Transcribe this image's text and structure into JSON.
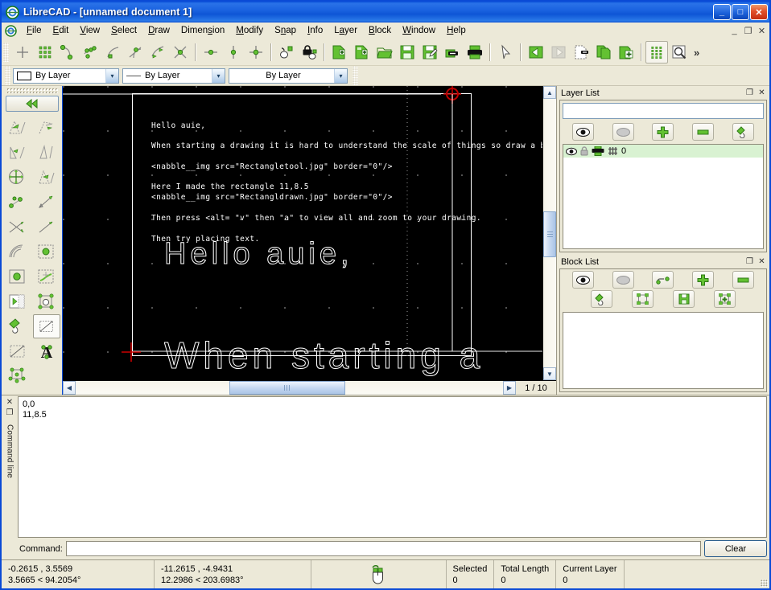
{
  "window": {
    "title": "LibreCAD - [unnamed document 1]",
    "minimize": "_",
    "maximize": "□",
    "close": "✕"
  },
  "menubar": {
    "items": [
      {
        "label": "File"
      },
      {
        "label": "Edit"
      },
      {
        "label": "View"
      },
      {
        "label": "Select"
      },
      {
        "label": "Draw"
      },
      {
        "label": "Dimension"
      },
      {
        "label": "Modify"
      },
      {
        "label": "Snap"
      },
      {
        "label": "Info"
      },
      {
        "label": "Layer"
      },
      {
        "label": "Block"
      },
      {
        "label": "Window"
      },
      {
        "label": "Help"
      }
    ],
    "mdi_minimize": "_",
    "mdi_restore": "❐",
    "mdi_close": "✕"
  },
  "toolbar": {
    "snap_tools": [
      "snap-free-icon",
      "snap-grid-icon",
      "snap-endpoint-icon",
      "snap-entity-icon",
      "snap-on-entity-icon",
      "snap-center-icon",
      "snap-middle-icon",
      "snap-intersection-icon"
    ],
    "restrict_tools": [
      "restrict-horizontal-icon",
      "restrict-vertical-icon",
      "restrict-orthogonal-icon"
    ],
    "lock_tools": [
      "relative-zero-icon",
      "lock-relative-zero-icon"
    ],
    "file_tools": [
      "new-file-icon",
      "new-from-template-icon",
      "open-file-icon",
      "save-icon",
      "save-as-icon",
      "export-icon",
      "print-icon"
    ],
    "edit_tools": [
      "select-pointer-icon",
      "undo-icon",
      "redo-icon",
      "cut-icon",
      "copy-icon",
      "paste-icon"
    ],
    "view_tools": [
      "grid-toggle-icon",
      "zoom-window-icon"
    ],
    "overflow": "»"
  },
  "combobar": {
    "color_combo": {
      "value": "By Layer",
      "icon": "color-swatch-icon"
    },
    "linetype_combo": {
      "value": "By Layer",
      "icon": "linetype-sample-icon"
    },
    "linewidth_combo": {
      "value": "By Layer"
    },
    "arrow": "▾"
  },
  "toolpalette": {
    "back_label": "◀◀",
    "back_icon": "back-arrows-icon",
    "tools": [
      {
        "name": "dim-aligned-icon"
      },
      {
        "name": "dim-linear-icon"
      },
      {
        "name": "dim-horizontal-icon"
      },
      {
        "name": "dim-vertical-icon"
      },
      {
        "name": "dim-radial-icon"
      },
      {
        "name": "dim-angular-icon"
      },
      {
        "name": "dim-leader-icon"
      },
      {
        "name": "dim-diametric-icon"
      },
      {
        "name": "dim-ordinate-icon"
      },
      {
        "name": "dim-baseline-icon"
      },
      {
        "name": "dim-arc-icon"
      },
      {
        "name": "hatch-area-icon"
      },
      {
        "name": "point-insert-icon"
      },
      {
        "name": "spline-edit-icon"
      },
      {
        "name": "image-insert-icon"
      },
      {
        "name": "block-create-icon"
      },
      {
        "name": "hatch-fill-icon"
      },
      {
        "name": "rectangle-tool-icon",
        "selected": true
      },
      {
        "name": "polyline-tool-icon"
      },
      {
        "name": "text-tool-icon"
      },
      {
        "name": "block-explode-icon"
      }
    ]
  },
  "canvas": {
    "lines": [
      "Hello auie,",
      "When starting a drawing it is hard to understand the scale of things so draw a border",
      "<nabble__img src=\"Rectangletool.jpg\" border=\"0\"/>",
      "Here I made the rectangle 11,8.5",
      "<nabble__img src=\"Rectangldrawn.jpg\" border=\"0\"/>",
      "Then press <alt= \"v\" then \"a\" to view all and zoom to your drawing.",
      "Then try placing text."
    ],
    "big_text_1": "Hello auie,",
    "big_text_2": "When starting a",
    "marker": "relative-zero-marker-icon",
    "page_indicator": "1 / 10"
  },
  "layer_panel": {
    "title": "Layer List",
    "restore_btn": "❐",
    "close_btn": "✕",
    "filter_placeholder": "",
    "buttons": [
      {
        "name": "show-all-layers-icon"
      },
      {
        "name": "hide-all-layers-icon"
      },
      {
        "name": "add-layer-icon"
      },
      {
        "name": "remove-layer-icon"
      },
      {
        "name": "edit-layer-icon"
      }
    ],
    "layers": [
      {
        "name": "0",
        "visible_icon": "eye-icon",
        "lock_icon": "lock-icon",
        "print_icon": "printer-icon",
        "construction_icon": "hatch-icon"
      }
    ]
  },
  "block_panel": {
    "title": "Block List",
    "restore_btn": "❐",
    "close_btn": "✕",
    "buttons": [
      {
        "name": "show-all-blocks-icon"
      },
      {
        "name": "hide-all-blocks-icon"
      },
      {
        "name": "toggle-block-view-icon"
      },
      {
        "name": "add-block-icon"
      },
      {
        "name": "remove-block-icon"
      },
      {
        "name": "edit-block-icon"
      },
      {
        "name": "insert-block-icon"
      },
      {
        "name": "save-block-icon"
      },
      {
        "name": "create-block-icon"
      }
    ],
    "blocks": []
  },
  "command_panel": {
    "dock_label": "Command line",
    "close_btn": "✕",
    "restore_btn": "❐",
    "history": [
      "0,0",
      "11,8.5"
    ],
    "input_label": "Command:",
    "input_value": "",
    "clear_label": "Clear"
  },
  "statusbar": {
    "absolute_coord": "-0.2615 , 3.5569",
    "absolute_polar": "3.5665 < 94.2054°",
    "relative_coord": "-11.2615 , -4.9431",
    "relative_polar": "12.2986 < 203.6983°",
    "mouse_icon": "mouse-widget-icon",
    "selected_label": "Selected",
    "selected_value": "0",
    "total_length_label": "Total Length",
    "total_length_value": "0",
    "current_layer_label": "Current Layer",
    "current_layer_value": "0"
  },
  "colors": {
    "title_blue": "#0a51d8",
    "chrome": "#ece9d8",
    "canvas_bg": "#000000",
    "accent_green": "#63c132",
    "layer_row_highlight": "#d9f2d2",
    "marker_red": "#c00000"
  }
}
